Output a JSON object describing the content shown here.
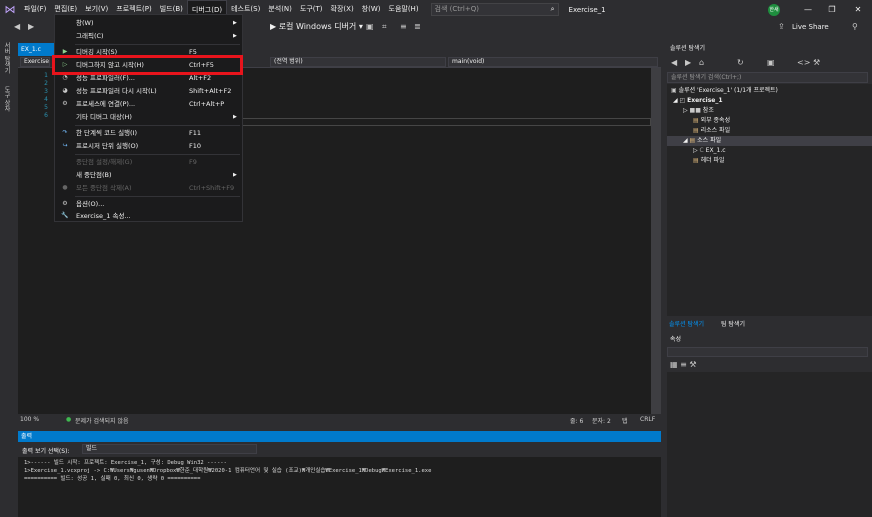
{
  "menubar": {
    "items": [
      "파일(F)",
      "편집(E)",
      "보기(V)",
      "프로젝트(P)",
      "빌드(B)",
      "디버그(D)",
      "테스트(S)",
      "분석(N)",
      "도구(T)",
      "확장(X)",
      "창(W)",
      "도움말(H)"
    ],
    "search_placeholder": "검색 (Ctrl+Q)",
    "window_title": "Exercise_1",
    "avatar_text": "한새",
    "controls": [
      "—",
      "❐",
      "✕"
    ]
  },
  "toolbar": {
    "run_label": "▶ 로컬 Windows 디버거 ▾",
    "live_share": "Live Share"
  },
  "left_tabs": [
    "서버 탐색기",
    "도구 상자"
  ],
  "editor": {
    "doc_tab": "EX_1.c",
    "nav_scope": "(전역 범위)",
    "nav_function": "main(void)",
    "nav_project": "Exercise",
    "line_numbers": [
      "1",
      "2",
      "3",
      "4",
      "5",
      "6"
    ],
    "zoom": "100 %",
    "status_message": "문제가 검색되지 않음",
    "line": "줄: 6",
    "char": "문자: 2",
    "mode": "탭",
    "eol": "CRLF"
  },
  "debug_menu": {
    "items": [
      {
        "icon": "",
        "label": "창(W)",
        "key": "",
        "submenu": true,
        "enabled": true
      },
      {
        "icon": "",
        "label": "그래픽(C)",
        "key": "",
        "submenu": true,
        "enabled": true
      },
      {
        "icon": "▶",
        "label": "디버깅 시작(S)",
        "key": "F5",
        "submenu": false,
        "enabled": true
      },
      {
        "icon": "▷",
        "label": "디버그하지 않고 시작(H)",
        "key": "Ctrl+F5",
        "submenu": false,
        "enabled": true
      },
      {
        "icon": "◔",
        "label": "성능 프로파일러(F)...",
        "key": "Alt+F2",
        "submenu": false,
        "enabled": true
      },
      {
        "icon": "◕",
        "label": "성능 프로파일러 다시 시작(L)",
        "key": "Shift+Alt+F2",
        "submenu": false,
        "enabled": true
      },
      {
        "icon": "⚙",
        "label": "프로세스에 연결(P)...",
        "key": "Ctrl+Alt+P",
        "submenu": false,
        "enabled": true
      },
      {
        "icon": "",
        "label": "기타 디버그 대상(H)",
        "key": "",
        "submenu": true,
        "enabled": true
      },
      {
        "icon": "↷",
        "label": "한 단계씩 코드 실행(I)",
        "key": "F11",
        "submenu": false,
        "enabled": true
      },
      {
        "icon": "↪",
        "label": "프로시저 단위 실행(O)",
        "key": "F10",
        "submenu": false,
        "enabled": true
      },
      {
        "icon": "",
        "label": "중단점 설정/해제(G)",
        "key": "F9",
        "submenu": false,
        "enabled": false
      },
      {
        "icon": "",
        "label": "새 중단점(B)",
        "key": "",
        "submenu": true,
        "enabled": true
      },
      {
        "icon": "",
        "label": "모든 중단점 삭제(A)",
        "key": "Ctrl+Shift+F9",
        "submenu": false,
        "enabled": false
      },
      {
        "icon": "⚙",
        "label": "옵션(O)...",
        "key": "",
        "submenu": false,
        "enabled": true
      },
      {
        "icon": "🔧",
        "label": "Exercise_1 속성...",
        "key": "",
        "submenu": false,
        "enabled": true
      }
    ]
  },
  "output": {
    "title": "출력",
    "source_label": "출력 보기 선택(S):",
    "source_value": "빌드",
    "lines": [
      "1>------ 빌드 시작: 프로젝트: Exercise_1, 구성: Debug Win32 ------",
      "1>Exercise_1.vcxproj -> C:₩Users₩gusen₩Dropbox₩한준_대학원₩2020-1 컴퓨터언어 및 실습 (조교)₩개인실습₩Exercise_1₩Debug₩Exercise_1.exe",
      "========== 빌드: 성공 1, 실패 0, 최신 0, 생략 0 =========="
    ]
  },
  "solution_explorer": {
    "title": "솔루션 탐색기",
    "search_placeholder": "솔루션 탐색기 검색(Ctrl+;)",
    "tree": [
      {
        "label": "솔루션 'Exercise_1' (1/1개 프로젝트)",
        "icon": "▣"
      },
      {
        "label": "Exercise_1",
        "icon": "◰"
      },
      {
        "label": "참조",
        "icon": "■■"
      },
      {
        "label": "외부 종속성",
        "icon": "▤"
      },
      {
        "label": "리소스 파일",
        "icon": "▤"
      },
      {
        "label": "소스 파일",
        "icon": "▤"
      },
      {
        "label": "EX_1.c",
        "icon": "C"
      },
      {
        "label": "헤더 파일",
        "icon": "▤"
      }
    ],
    "tabs": [
      "솔루션 탐색기",
      "팀 탐색기"
    ]
  },
  "properties": {
    "title": "속성"
  },
  "colors": {
    "accent": "#007acc",
    "highlight_box": "#e8141c",
    "background": "#2d2d30",
    "editor_bg": "#1e1e1e"
  }
}
